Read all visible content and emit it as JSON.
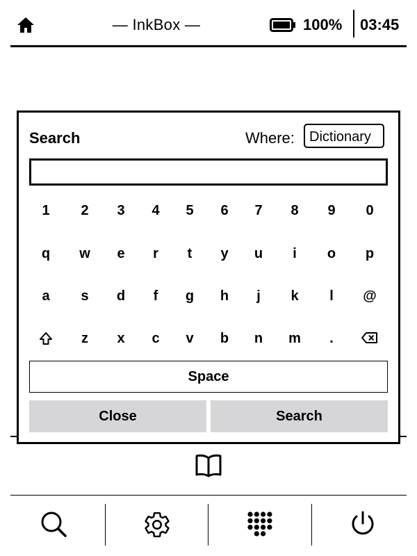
{
  "status_bar": {
    "app_title": "— InkBox —",
    "battery_percent": "100%",
    "battery_level": 1.0,
    "time": "03:45",
    "icons": [
      "home-icon",
      "battery-icon"
    ]
  },
  "search_dialog": {
    "title": "Search",
    "where_label": "Where:",
    "where_value": "Dictionary",
    "input_value": "",
    "keyboard": {
      "row1": [
        "1",
        "2",
        "3",
        "4",
        "5",
        "6",
        "7",
        "8",
        "9",
        "0"
      ],
      "row2": [
        "q",
        "w",
        "e",
        "r",
        "t",
        "y",
        "u",
        "i",
        "o",
        "p"
      ],
      "row3": [
        "a",
        "s",
        "d",
        "f",
        "g",
        "h",
        "j",
        "k",
        "l",
        "@"
      ],
      "row4": [
        "shift-icon",
        "z",
        "x",
        "c",
        "v",
        "b",
        "n",
        "m",
        ".",
        "backspace-icon"
      ]
    },
    "space_label": "Space",
    "close_label": "Close",
    "search_label": "Search"
  },
  "bottom_nav": {
    "center_icon": "book-icon",
    "buttons": [
      "search-icon",
      "gear-icon",
      "apps-grid-icon",
      "power-icon"
    ]
  }
}
